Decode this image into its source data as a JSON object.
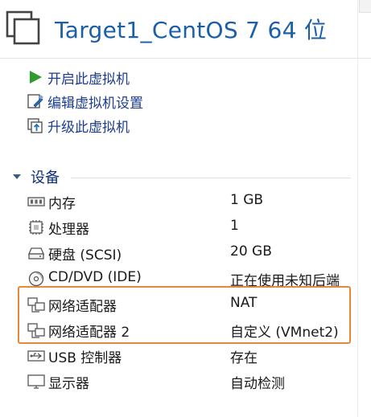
{
  "title": "Target1_CentOS 7 64 位",
  "actions": [
    {
      "label": "开启此虚拟机",
      "icon": "play-icon"
    },
    {
      "label": "编辑虚拟机设置",
      "icon": "edit-settings-icon"
    },
    {
      "label": "升级此虚拟机",
      "icon": "upgrade-icon"
    }
  ],
  "section_label": "设备",
  "devices": [
    {
      "name": "内存",
      "value": "1 GB",
      "icon": "memory-icon"
    },
    {
      "name": "处理器",
      "value": "1",
      "icon": "processor-icon"
    },
    {
      "name": "硬盘 (SCSI)",
      "value": "20 GB",
      "icon": "hard-disk-icon"
    },
    {
      "name": "CD/DVD (IDE)",
      "value": "正在使用未知后端",
      "icon": "cd-dvd-icon"
    },
    {
      "name": "网络适配器",
      "value": "NAT",
      "icon": "network-adapter-icon"
    },
    {
      "name": "网络适配器 2",
      "value": "自定义 (VMnet2)",
      "icon": "network-adapter-icon"
    },
    {
      "name": "USB 控制器",
      "value": "存在",
      "icon": "usb-icon"
    },
    {
      "name": "显示器",
      "value": "自动检测",
      "icon": "display-icon"
    }
  ],
  "colors": {
    "title": "#1a5fa8",
    "link": "#1e3d8f",
    "section": "#0f2f7a",
    "highlight": "#e8893a",
    "play": "#2e9b2e"
  }
}
